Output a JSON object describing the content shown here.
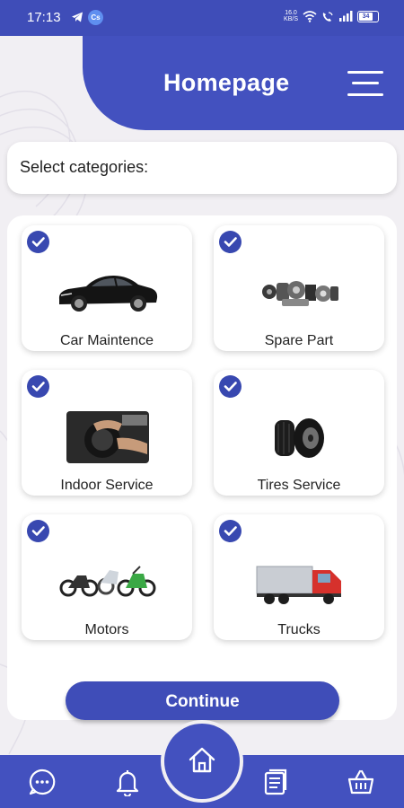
{
  "status_bar": {
    "time": "17:13",
    "net_speed_top": "16.0",
    "net_speed_bottom": "KB/S",
    "battery": "34",
    "notification_badge": "Cs"
  },
  "header": {
    "title": "Homepage"
  },
  "select": {
    "label": "Select categories:"
  },
  "categories": [
    {
      "label": "Car Maintence",
      "checked": true,
      "icon": "car"
    },
    {
      "label": "Spare Part",
      "checked": true,
      "icon": "spare-parts"
    },
    {
      "label": "Indoor Service",
      "checked": true,
      "icon": "indoor-service"
    },
    {
      "label": "Tires Service",
      "checked": true,
      "icon": "tires"
    },
    {
      "label": "Motors",
      "checked": true,
      "icon": "motorcycles"
    },
    {
      "label": "Trucks",
      "checked": true,
      "icon": "truck"
    }
  ],
  "continue_label": "Continue",
  "bottom_nav": [
    "chat-icon",
    "bell-icon",
    "home-icon",
    "document-icon",
    "basket-icon"
  ],
  "colors": {
    "primary": "#4351bf",
    "check": "#3848b0",
    "background": "#f1eff3"
  }
}
